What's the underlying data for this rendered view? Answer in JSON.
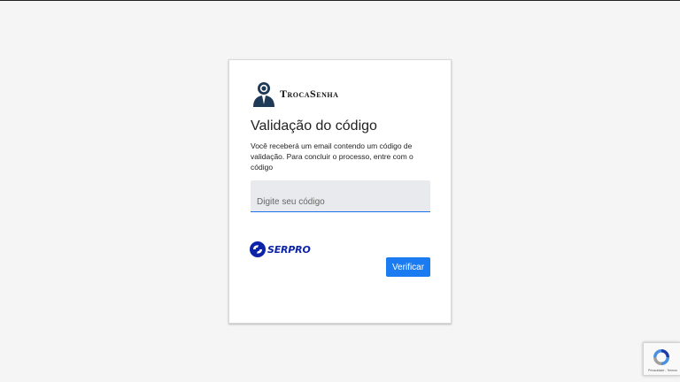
{
  "app": {
    "brand_name": "TrocaSenha"
  },
  "form": {
    "title": "Validação do código",
    "description": "Você receberá um email contendo um código de validação. Para concluir o processo, entre com o código",
    "code_input": {
      "value": "",
      "placeholder": "Digite seu código"
    },
    "verify_label": "Verificar"
  },
  "footer": {
    "partner_logo_text": "SERPRO"
  },
  "recaptcha": {
    "links_text": "Privacidade - Termos"
  },
  "icons": {
    "brand": "user-key-icon",
    "partner": "serpro-logo-icon",
    "captcha": "recaptcha-icon"
  },
  "colors": {
    "accent": "#1a7cf0",
    "serpro": "#0d23a8",
    "brand_icon": "#1f3a57"
  }
}
